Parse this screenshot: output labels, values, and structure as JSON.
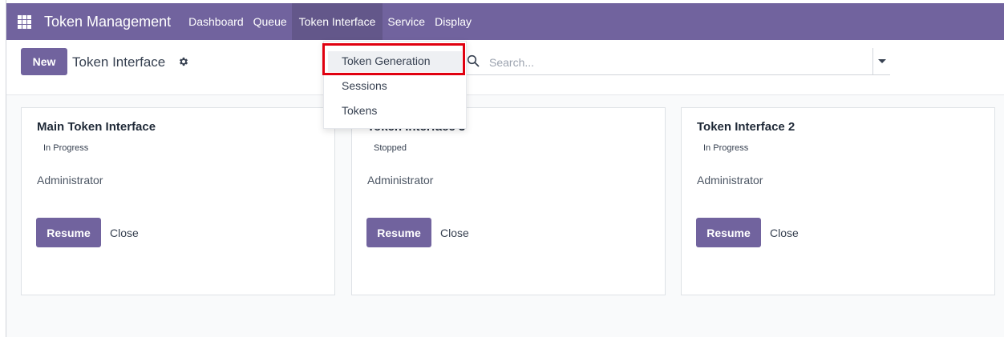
{
  "navbar": {
    "brand": "Token Management",
    "menu": [
      "Dashboard",
      "Queue",
      "Token Interface",
      "Service",
      "Display"
    ],
    "active_menu": "Token Interface",
    "color": "#71639e"
  },
  "control_panel": {
    "new_label": "New",
    "title": "Token Interface",
    "search_placeholder": "Search..."
  },
  "dropdown": {
    "items": [
      "Token Generation",
      "Sessions",
      "Tokens"
    ],
    "highlighted": "Token Generation"
  },
  "cards": [
    {
      "title": "Main Token Interface",
      "status": "In Progress",
      "user": "Administrator",
      "resume_label": "Resume",
      "close_label": "Close"
    },
    {
      "title": "Token Interface 3",
      "status": "Stopped",
      "user": "Administrator",
      "resume_label": "Resume",
      "close_label": "Close"
    },
    {
      "title": "Token Interface 2",
      "status": "In Progress",
      "user": "Administrator",
      "resume_label": "Resume",
      "close_label": "Close"
    }
  ],
  "icons": {
    "apps": "apps-grid-icon",
    "gear": "gear-icon",
    "search": "search-icon",
    "caret": "caret-down-icon"
  }
}
